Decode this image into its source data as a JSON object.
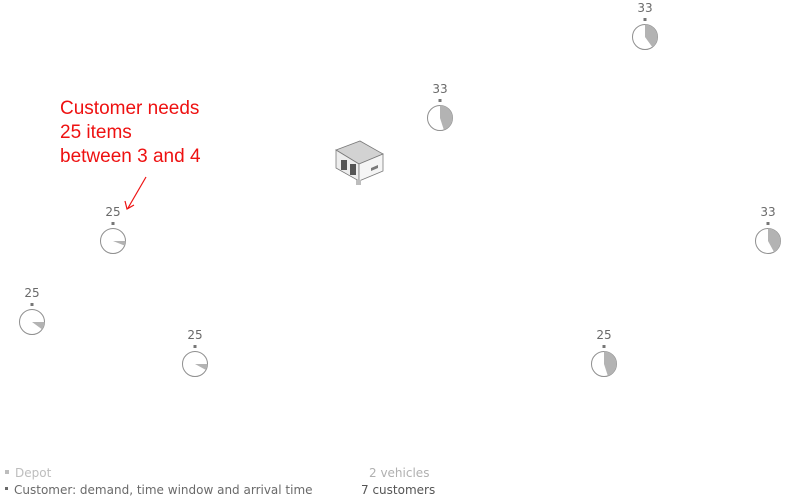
{
  "annotation": {
    "lines": [
      "Customer needs",
      "25 items",
      "between 3 and 4"
    ],
    "color": "#ee1111"
  },
  "depot": {
    "icon": "warehouse-icon"
  },
  "customers": [
    {
      "id": "c1",
      "demand": "33",
      "window_fraction": 0.4
    },
    {
      "id": "c2",
      "demand": "33",
      "window_fraction": 0.45
    },
    {
      "id": "c3",
      "demand": "25",
      "window_fraction": 0.06
    },
    {
      "id": "c4",
      "demand": "33",
      "window_fraction": 0.42
    },
    {
      "id": "c5",
      "demand": "25",
      "window_fraction": 0.1
    },
    {
      "id": "c6",
      "demand": "25",
      "window_fraction": 0.08
    },
    {
      "id": "c7",
      "demand": "25",
      "window_fraction": 0.45
    }
  ],
  "legend": {
    "depot_label": "Depot",
    "depot_color": "#bdbdbd",
    "customer_label": "Customer: demand, time window and arrival time",
    "customer_color": "#6a6a6a"
  },
  "stats": {
    "vehicles": "2 vehicles",
    "vehicles_color": "#b0b0b0",
    "customers": "7 customers",
    "customers_color": "#555555"
  },
  "colors": {
    "fill": "#b3b3b3",
    "stroke": "#8f8f8f"
  }
}
